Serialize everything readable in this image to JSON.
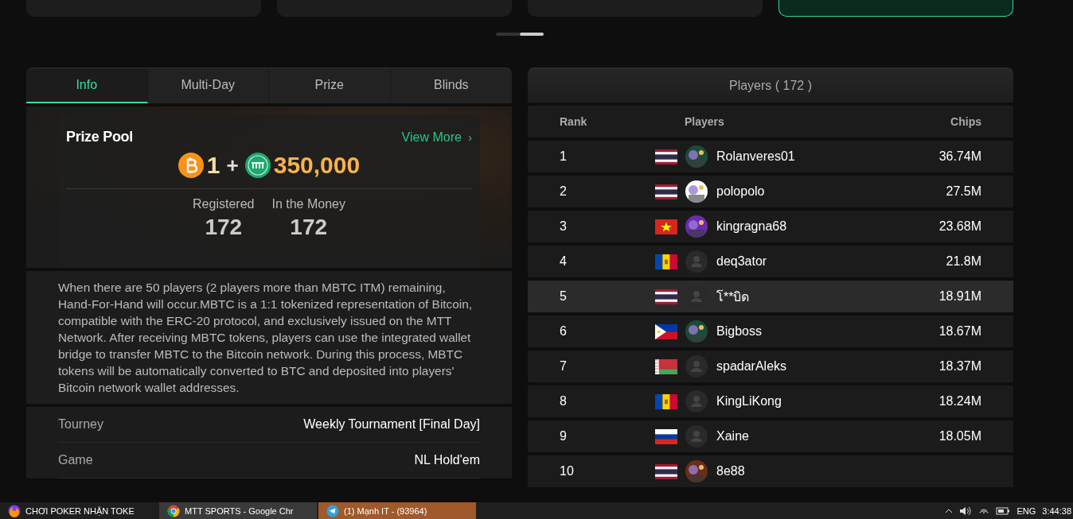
{
  "carousel": {
    "cards": [
      {
        "selected": false
      },
      {
        "selected": false
      },
      {
        "selected": false
      },
      {
        "selected": true
      }
    ],
    "pager": [
      {
        "selected": false
      },
      {
        "selected": true
      }
    ]
  },
  "info_panel": {
    "tabs": [
      {
        "label": "Info",
        "selected": true
      },
      {
        "label": "Multi-Day",
        "selected": false
      },
      {
        "label": "Prize",
        "selected": false
      },
      {
        "label": "Blinds",
        "selected": false
      }
    ],
    "prize_pool": {
      "title": "Prize Pool",
      "link": "View More",
      "link_arrow": "›",
      "first_amount": "1",
      "plus": "+",
      "second_amount": "350,000",
      "stats": [
        {
          "label": "Registered",
          "value": "172"
        },
        {
          "label": "In the Money",
          "value": "172"
        }
      ]
    },
    "description": "When there are 50 players (2 players more than MBTC ITM) remaining, Hand-For-Hand will occur.MBTC is a 1:1 tokenized representation of Bitcoin, compatible with the ERC-20 protocol, and exclusively issued on the MTT Network. After receiving MBTC tokens, players can use the integrated wallet bridge to transfer MBTC to the Bitcoin network. During this process, MBTC tokens will be automatically converted to BTC and deposited into players' Bitcoin network wallet addresses.",
    "details": [
      {
        "label": "Tourney",
        "value": "Weekly Tournament [Final Day]"
      },
      {
        "label": "Game",
        "value": "NL Hold'em"
      }
    ]
  },
  "players_panel": {
    "title": "Players ( 172 )",
    "columns": [
      "Rank",
      "Players",
      "Chips"
    ],
    "rows": [
      {
        "rank": "1",
        "flag": {
          "kind": "th"
        },
        "name": "Rolanveres01",
        "chips": "36.74M",
        "selected": false
      },
      {
        "rank": "2",
        "flag": {
          "kind": "th"
        },
        "name": "polopolo",
        "chips": "27.5M",
        "selected": false
      },
      {
        "rank": "3",
        "flag": {
          "kind": "vn"
        },
        "name": "kingragna68",
        "chips": "23.68M",
        "selected": false
      },
      {
        "rank": "4",
        "flag": {
          "kind": "md"
        },
        "avatar": {
          "kind": "default"
        },
        "name": "deq3ator",
        "chips": "21.8M",
        "selected": false
      },
      {
        "rank": "5",
        "flag": {
          "kind": "th"
        },
        "avatar": {
          "kind": "default"
        },
        "name": "โ**บิด",
        "chips": "18.91M",
        "selected": true
      },
      {
        "rank": "6",
        "flag": {
          "kind": "ph"
        },
        "name": "Bigboss",
        "chips": "18.67M",
        "selected": false
      },
      {
        "rank": "7",
        "flag": {
          "kind": "by"
        },
        "avatar": {
          "kind": "default"
        },
        "name": "spadarAleks",
        "chips": "18.37M",
        "selected": false
      },
      {
        "rank": "8",
        "flag": {
          "kind": "md"
        },
        "avatar": {
          "kind": "default"
        },
        "name": "KingLiKong",
        "chips": "18.24M",
        "selected": false
      },
      {
        "rank": "9",
        "flag": {
          "kind": "ru"
        },
        "avatar": {
          "kind": "default"
        },
        "name": "Xaine",
        "chips": "18.05M",
        "selected": false
      },
      {
        "rank": "10",
        "flag": {
          "kind": "th"
        },
        "name": "8e88",
        "selected": false
      }
    ]
  },
  "taskbar": {
    "items": [
      {
        "kind": "firefox",
        "label": "CHƠI POKER NHẬN TOKE",
        "active": false,
        "attention": false
      },
      {
        "kind": "chrome",
        "label": "MTT SPORTS - Google Chr",
        "active": true,
        "attention": false
      },
      {
        "kind": "telegram",
        "label": "(1) Mạnh IT - (93964)",
        "active": false,
        "attention": true
      }
    ],
    "language": "ENG",
    "time": "3:44:38"
  }
}
